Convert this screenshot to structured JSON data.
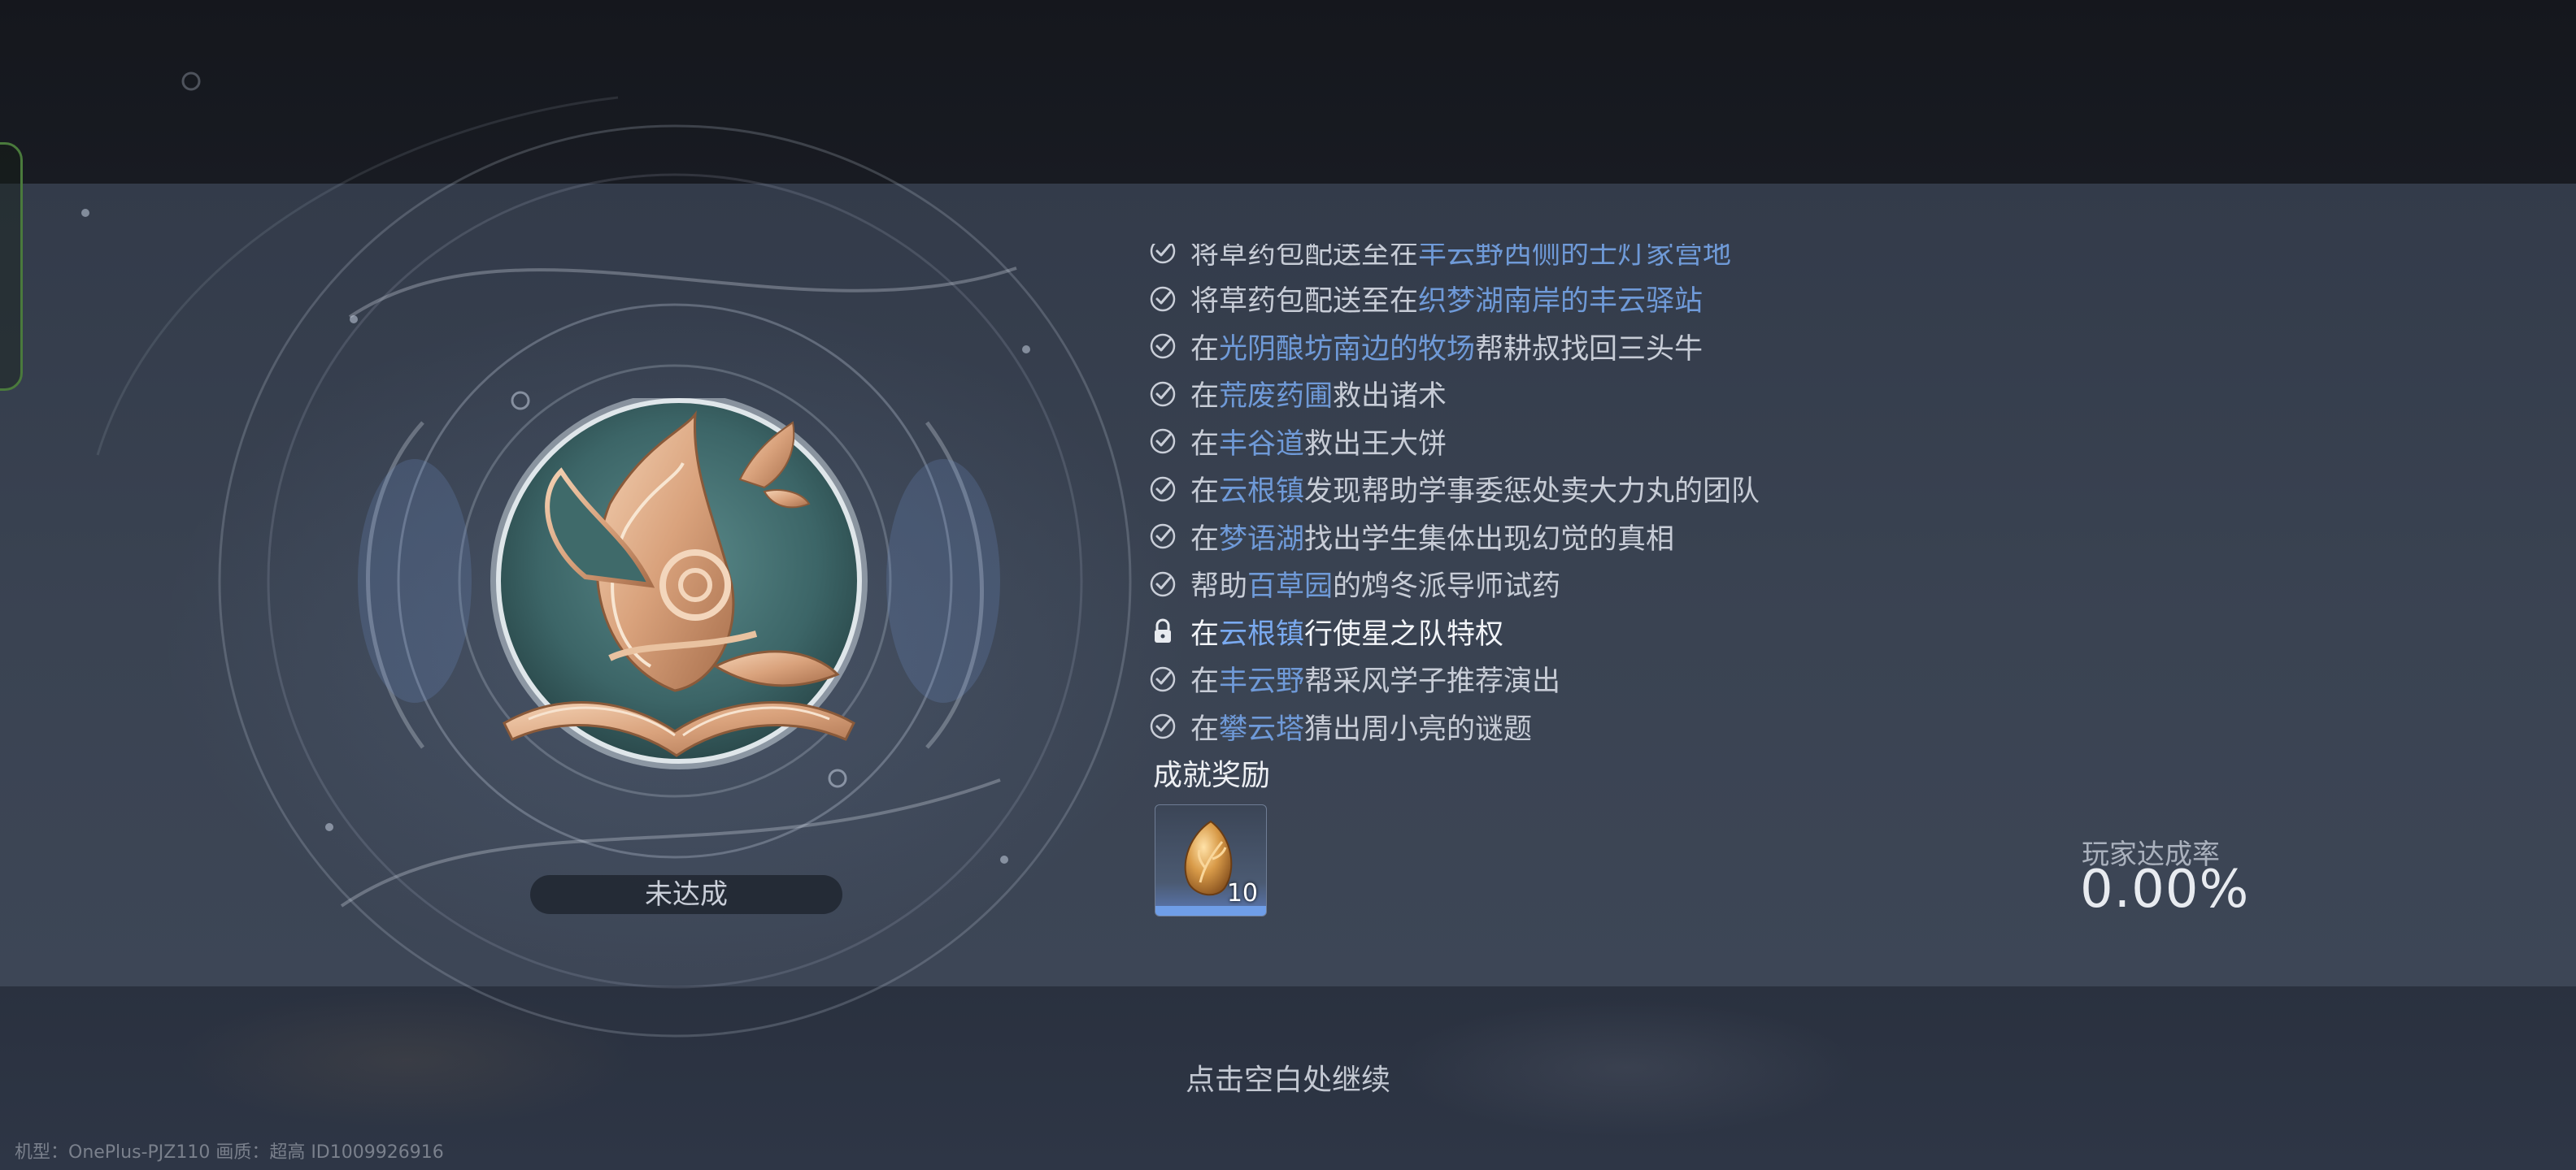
{
  "achievement": {
    "status": "未达成",
    "tasks": [
      {
        "pre": "将草药包配送至在",
        "place": "丰云野西侧的士灯家营地",
        "post": "",
        "state": "done"
      },
      {
        "pre": "将草药包配送至在",
        "place": "织梦湖南岸的丰云驿站",
        "post": "",
        "state": "done"
      },
      {
        "pre": "在",
        "place": "光阴酿坊南边的牧场",
        "post": "帮耕叔找回三头牛",
        "state": "done"
      },
      {
        "pre": "在",
        "place": "荒废药圃",
        "post": "救出诸术",
        "state": "done"
      },
      {
        "pre": "在",
        "place": "丰谷道",
        "post": "救出王大饼",
        "state": "done"
      },
      {
        "pre": "在",
        "place": "云根镇",
        "post": "发现帮助学事委惩处卖大力丸的团队",
        "state": "done"
      },
      {
        "pre": "在",
        "place": "梦语湖",
        "post": "找出学生集体出现幻觉的真相",
        "state": "done"
      },
      {
        "pre": "帮助",
        "place": "百草园",
        "post": "的鸩冬派导师试药",
        "state": "done"
      },
      {
        "pre": "在",
        "place": "云根镇",
        "post": "行使星之队特权",
        "state": "locked"
      },
      {
        "pre": "在",
        "place": "丰云野",
        "post": "帮采风学子推荐演出",
        "state": "done"
      },
      {
        "pre": "在",
        "place": "攀云塔",
        "post": "猜出周小亮的谜题",
        "state": "done"
      }
    ],
    "reward_title": "成就奖励",
    "reward_item": {
      "icon": "golden-leaf-gem-icon",
      "quantity": "10"
    },
    "rate_label": "玩家达成率",
    "rate_value": "0.00%"
  },
  "continue_hint": "点击空白处继续",
  "device_info": "机型：OnePlus-PJZ110 画质：超高 ID1009926916",
  "colors": {
    "highlight": "#6f9ad8",
    "check": "#c9ced8",
    "reward_bar": "#6f9ee8"
  }
}
